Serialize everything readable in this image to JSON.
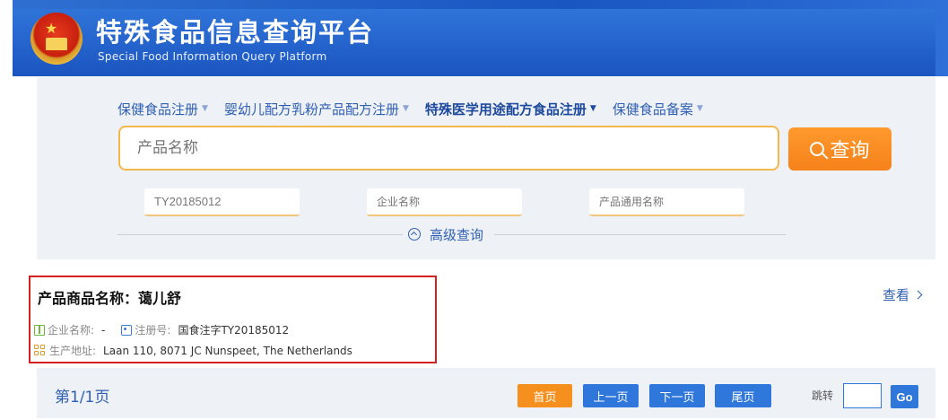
{
  "header": {
    "title_cn": "特殊食品信息查询平台",
    "title_en": "Special Food Information Query Platform",
    "emblem_icon": "national-emblem",
    "color": "#1b55c0"
  },
  "nav": {
    "items": [
      {
        "label": "保健食品注册",
        "active": false
      },
      {
        "label": "婴幼儿配方乳粉产品配方注册",
        "active": false
      },
      {
        "label": "特殊医学用途配方食品注册",
        "active": true
      },
      {
        "label": "保健食品备案",
        "active": false
      }
    ],
    "caret": "▼"
  },
  "search": {
    "main_placeholder": "产品名称",
    "button_label": "查询",
    "button_color": "#f5811a",
    "reg_no_value": "TY20185012",
    "enterprise_placeholder": "企业名称",
    "generic_name_placeholder": "产品通用名称",
    "advanced_label": "高级查询"
  },
  "result": {
    "title": "产品商品名称：蔼儿舒",
    "enterprise_label": "企业名称:",
    "enterprise_value": "-",
    "reg_label": "注册号:",
    "reg_value": "国食注字TY20185012",
    "address_label": "生产地址:",
    "address_value": "Laan 110, 8071 JC Nunspeet, The Netherlands",
    "view_label": "查看",
    "highlight_color": "#d42020"
  },
  "pager": {
    "info": "第1/1页",
    "first": "首页",
    "prev": "上一页",
    "next": "下一页",
    "last": "尾页",
    "jump_label": "跳转",
    "go": "Go"
  }
}
